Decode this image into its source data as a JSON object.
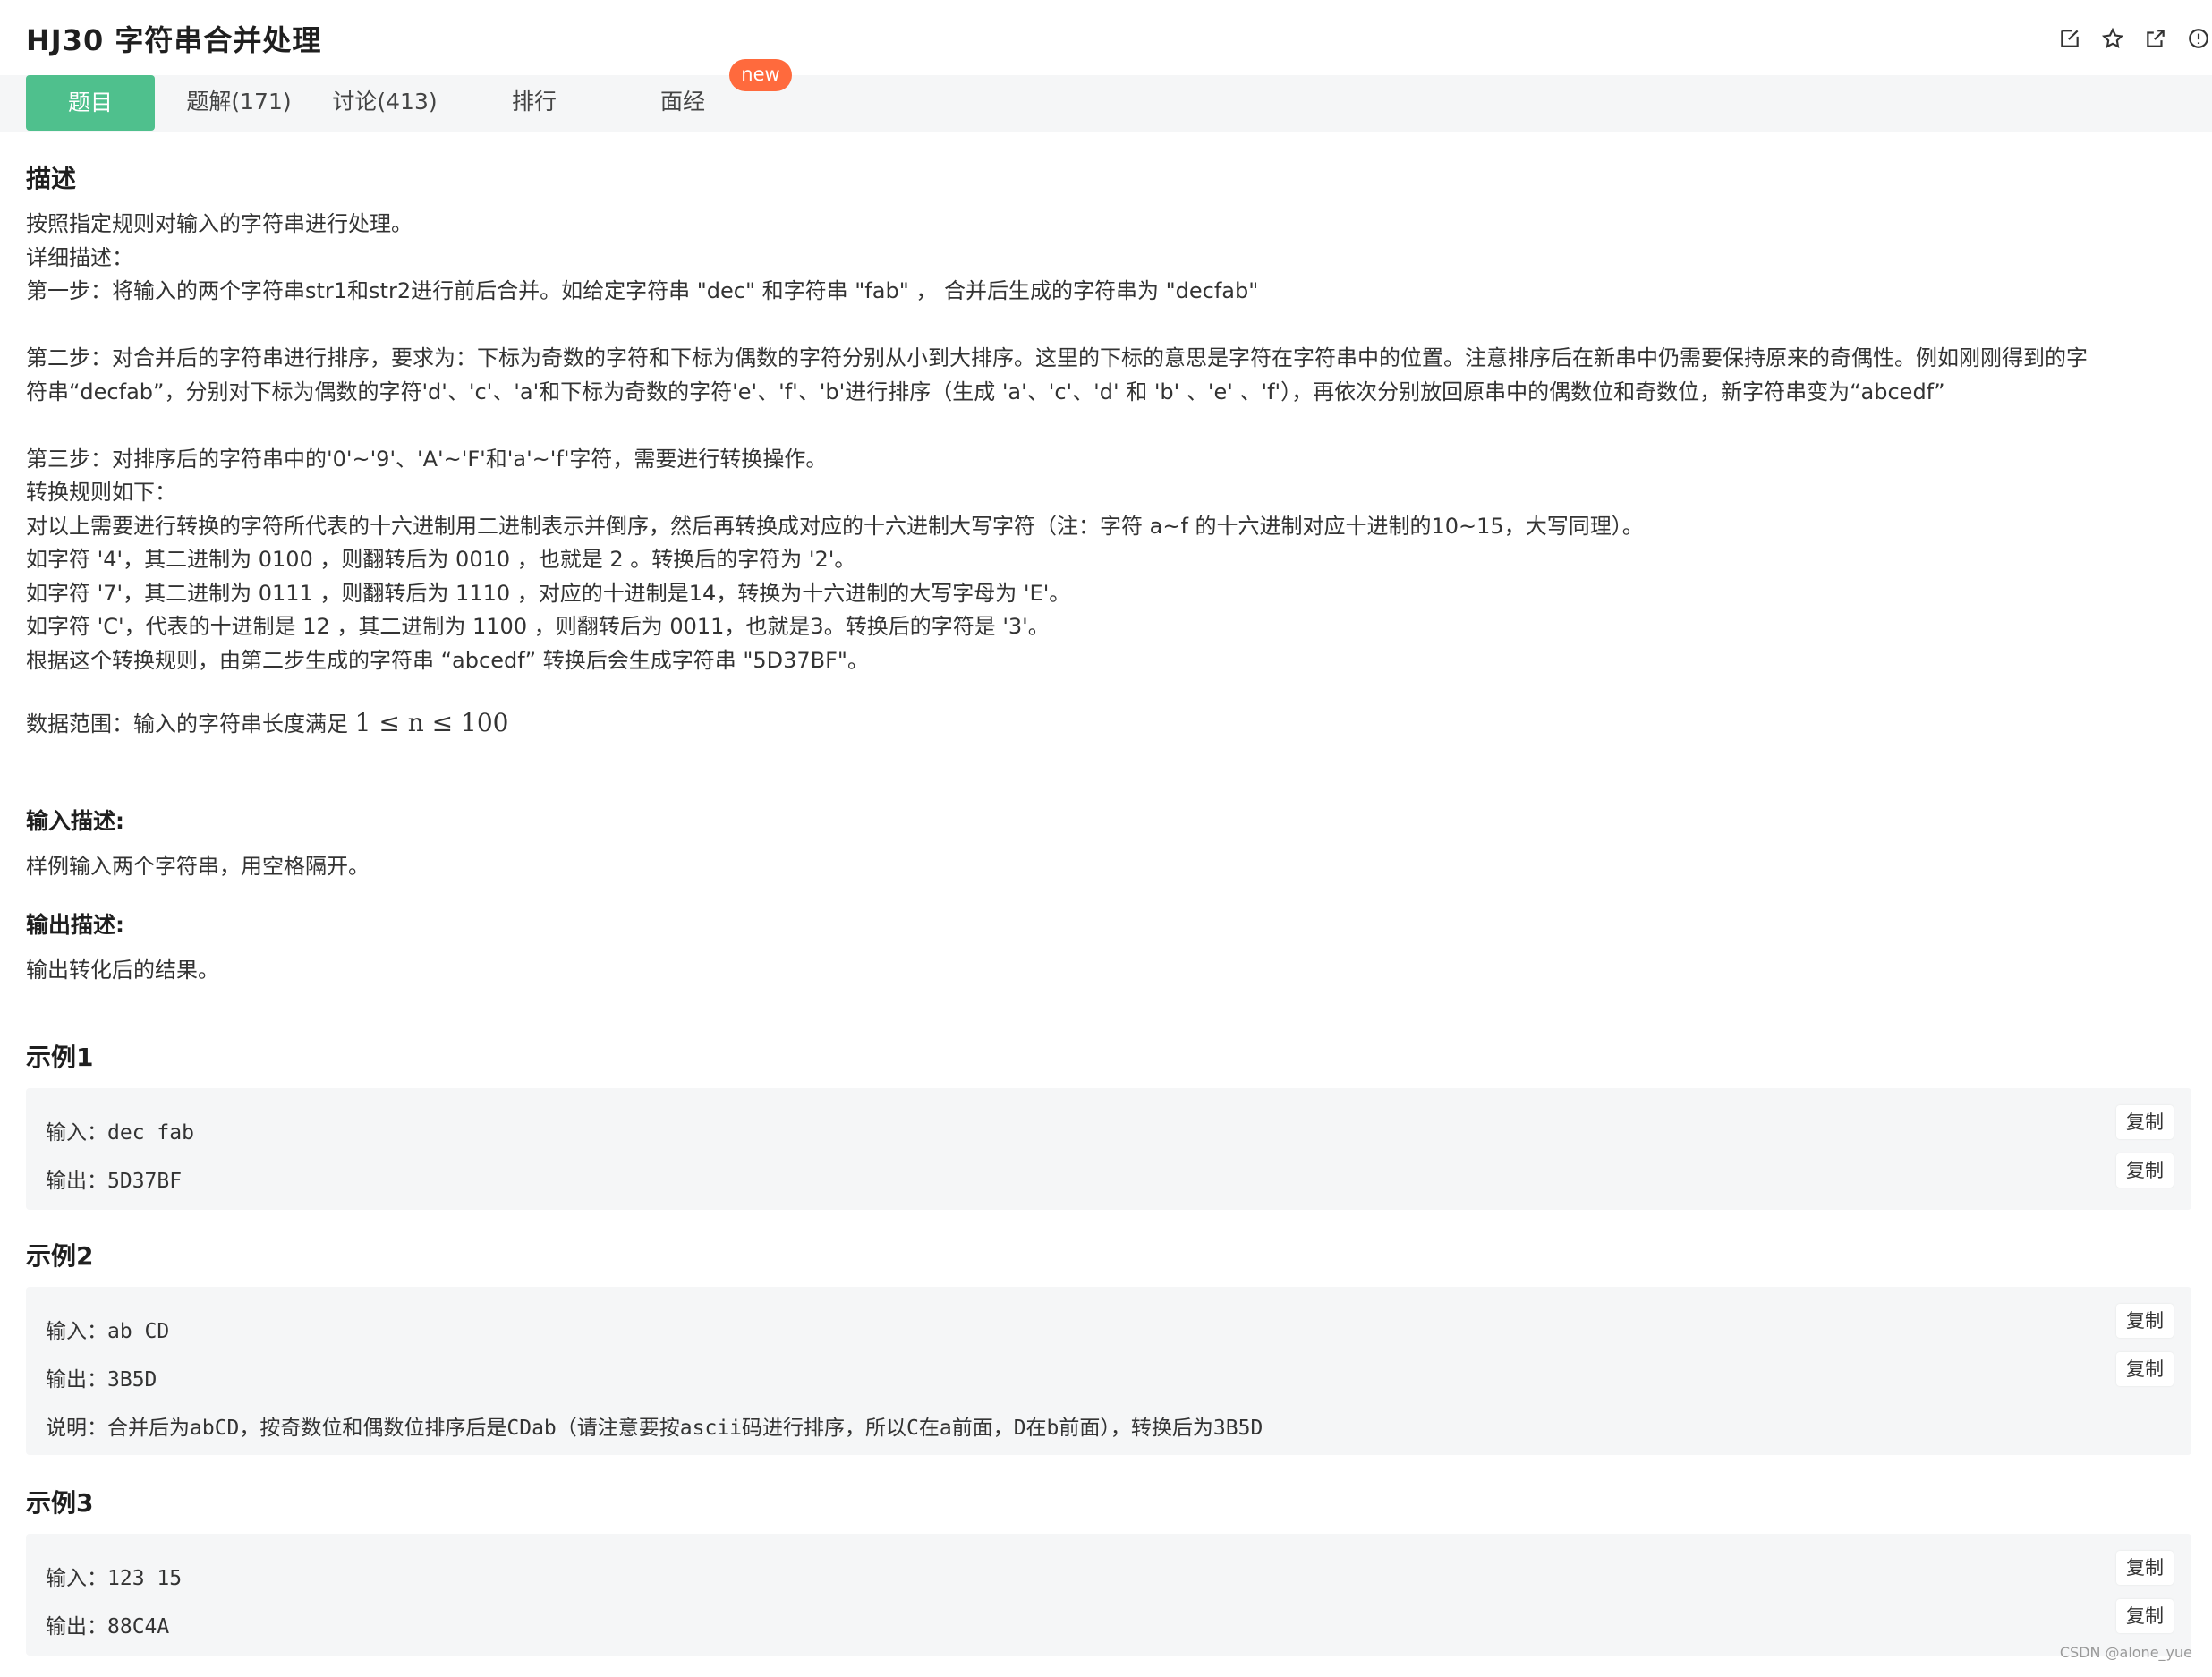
{
  "header": {
    "title": "HJ30  字符串合并处理"
  },
  "tabs": [
    {
      "label": "题目"
    },
    {
      "label": "题解(171)"
    },
    {
      "label": "讨论(413)"
    },
    {
      "label": "排行"
    },
    {
      "label": "面经"
    }
  ],
  "new_badge": "new",
  "colors": {
    "accent": "#4fc08d",
    "badge": "#ff6a3d",
    "panel": "#f5f6f7"
  },
  "description": {
    "heading": "描述",
    "lines": [
      "按照指定规则对输入的字符串进行处理。",
      "详细描述：",
      "第一步：将输入的两个字符串str1和str2进行前后合并。如给定字符串 \"dec\" 和字符串 \"fab\" ， 合并后生成的字符串为 \"decfab\"",
      "",
      "第二步：对合并后的字符串进行排序，要求为：下标为奇数的字符和下标为偶数的字符分别从小到大排序。这里的下标的意思是字符在字符串中的位置。注意排序后在新串中仍需要保持原来的奇偶性。例如刚刚得到的字",
      "符串“decfab”，分别对下标为偶数的字符'd'、'c'、'a'和下标为奇数的字符'e'、'f'、'b'进行排序（生成 'a'、'c'、'd' 和 'b' 、'e' 、'f'），再依次分别放回原串中的偶数位和奇数位，新字符串变为“abcedf”",
      "",
      "第三步：对排序后的字符串中的'0'~'9'、'A'~'F'和'a'~'f'字符，需要进行转换操作。",
      "转换规则如下：",
      "对以上需要进行转换的字符所代表的十六进制用二进制表示并倒序，然后再转换成对应的十六进制大写字符（注：字符 a~f 的十六进制对应十进制的10~15，大写同理）。",
      "如字符 '4'，其二进制为 0100 ，则翻转后为 0010 ，也就是 2 。转换后的字符为 '2'。",
      "如字符 '7'，其二进制为 0111 ，则翻转后为 1110 ，对应的十进制是14，转换为十六进制的大写字母为 'E'。",
      "如字符 'C'，代表的十进制是 12 ，其二进制为 1100 ，则翻转后为 0011，也就是3。转换后的字符是 '3'。",
      "根据这个转换规则，由第二步生成的字符串 “abcedf” 转换后会生成字符串 \"5D37BF\"。"
    ],
    "range_label": "数据范围：输入的字符串长度满足 ",
    "range_math": "1 ≤ n ≤ 100"
  },
  "input_desc": {
    "heading": "输入描述:",
    "text": "样例输入两个字符串，用空格隔开。"
  },
  "output_desc": {
    "heading": "输出描述:",
    "text": "输出转化后的结果。"
  },
  "copy_label": "复制",
  "examples": [
    {
      "title": "示例1",
      "input_label": "输入：",
      "input": "dec fab",
      "output_label": "输出：",
      "output": "5D37BF"
    },
    {
      "title": "示例2",
      "input_label": "输入：",
      "input": "ab CD",
      "output_label": "输出：",
      "output": "3B5D",
      "note_label": "说明：",
      "note": "合并后为abCD，按奇数位和偶数位排序后是CDab（请注意要按ascii码进行排序，所以C在a前面，D在b前面），转换后为3B5D"
    },
    {
      "title": "示例3",
      "input_label": "输入：",
      "input": "123 15",
      "output_label": "输出：",
      "output": "88C4A"
    }
  ],
  "watermark": "CSDN @alone_yue"
}
